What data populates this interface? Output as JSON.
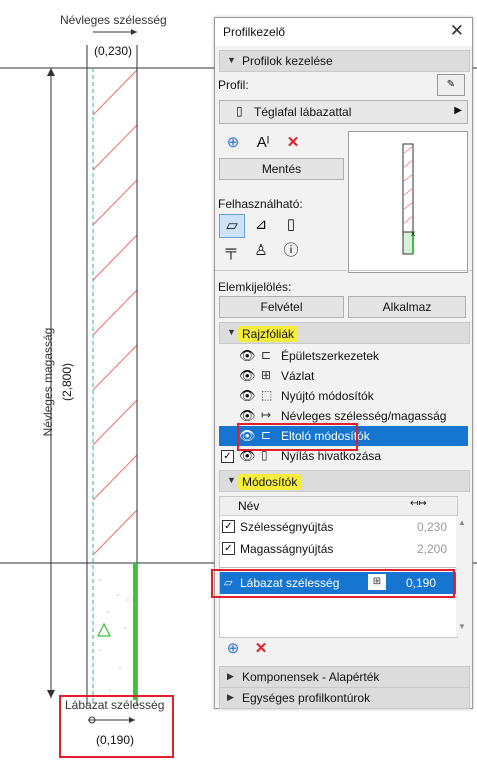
{
  "drawing": {
    "top_dimension": {
      "label": "Névleges szélesség",
      "value": "(0,230)"
    },
    "left_dimension": {
      "label": "Névleges magasság",
      "value": "(2,800)"
    },
    "bottom_dimension": {
      "label": "Lábazat szélesség",
      "value": "(0,190)"
    }
  },
  "panel": {
    "title": "Profilkezelő",
    "section_profiles": "Profilok kezelése",
    "profile_label": "Profil:",
    "profile_value": "Téglafal lábazattal",
    "save_button": "Mentés",
    "usable_label": "Felhasználható:",
    "selection_label": "Elemkijelölés:",
    "pick_button": "Felvétel",
    "apply_button": "Alkalmaz",
    "section_layers": "Rajzfóliák",
    "layers": [
      {
        "label": "Épületszerkezetek"
      },
      {
        "label": "Vázlat"
      },
      {
        "label": "Nyújtó módosítók"
      },
      {
        "label": "Névleges szélesség/magasság"
      },
      {
        "label": "Eltoló módosítók"
      },
      {
        "label": "Nyílás hivatkozása"
      }
    ],
    "section_modifiers": "Módosítók",
    "table_header": {
      "name": "Név"
    },
    "modifiers": [
      {
        "name": "Szélességnyújtás",
        "value": "0,230"
      },
      {
        "name": "Magasságnyújtás",
        "value": "2,200"
      }
    ],
    "offset_modifier": {
      "name": "Lábazat szélesség",
      "value": "0,190"
    },
    "section_components": "Komponensek - Alapérték",
    "section_contours": "Egységes profilkontúrok"
  },
  "colors": {
    "selection": "#1675d1",
    "highlight": "#f7ee3b",
    "annotation": "#e0202a"
  }
}
